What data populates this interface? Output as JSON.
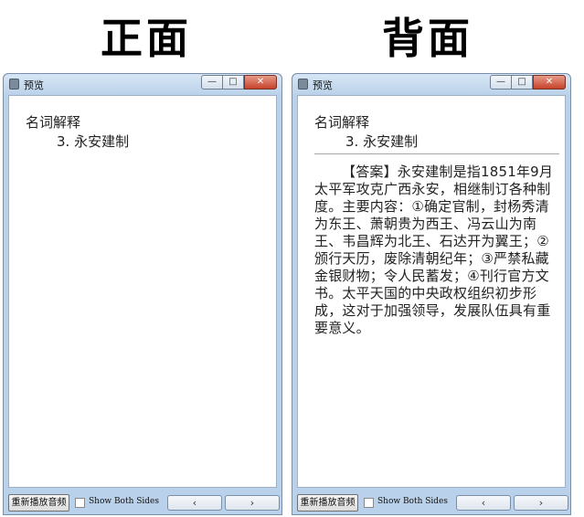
{
  "headings": {
    "front": "正面",
    "back": "背面"
  },
  "window": {
    "title": "预览",
    "minimize_icon": "—",
    "maximize_icon": "□",
    "close_icon": "✕"
  },
  "card": {
    "question_label": "名词解释",
    "question_item": "3. 永安建制",
    "answer": "【答案】永安建制是指1851年9月太平军攻克广西永安，相继制订各种制度。主要内容：①确定官制，封杨秀清为东王、萧朝贵为西王、冯云山为南王、韦昌辉为北王、石达开为翼王；②颁行天历，废除清朝纪年；③严禁私藏金银财物；令人民蓄发；④刊行官方文书。太平天国的中央政权组织初步形成，这对于加强领导，发展队伍具有重要意义。"
  },
  "controls": {
    "replay_audio": "重新播放音频",
    "show_both_sides": "Show Both Sides",
    "show_both_sides_checked": false,
    "prev": "‹",
    "next": "›"
  }
}
